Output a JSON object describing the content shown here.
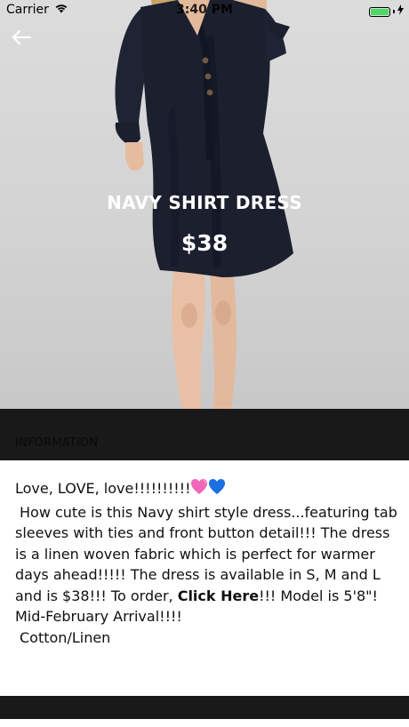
{
  "status_bar": {
    "carrier": "Carrier",
    "time": "3:40 PM",
    "battery_color": "#4cd964"
  },
  "product": {
    "title": "NAVY SHIRT DRESS",
    "price": "$38"
  },
  "section": {
    "information_label": "INFORMATION"
  },
  "description": {
    "line1": "Love, LOVE, love!!!!!!!!!!",
    "body_before_link": "How cute is this Navy shirt style dress...featuring tab sleeves with ties and front button detail!!! The dress is a linen woven fabric which is perfect for warmer days ahead!!!!! The dress is available in S, M and L and is $38!!! To order,",
    "link_text": "Click Here",
    "body_after_link": "!!! Model is 5'8\"! Mid-February Arrival!!!!",
    "material": "Cotton/Linen"
  },
  "icons": {
    "back": "back-arrow-icon",
    "wifi": "wifi-icon",
    "battery": "battery-icon",
    "charging": "charging-bolt-icon",
    "heart_pink": "pink-heart-icon",
    "heart_blue": "blue-heart-icon"
  },
  "colors": {
    "dress": "#1b1f2e",
    "background_gray": "#d3d3d3",
    "header_bar": "#191919"
  }
}
